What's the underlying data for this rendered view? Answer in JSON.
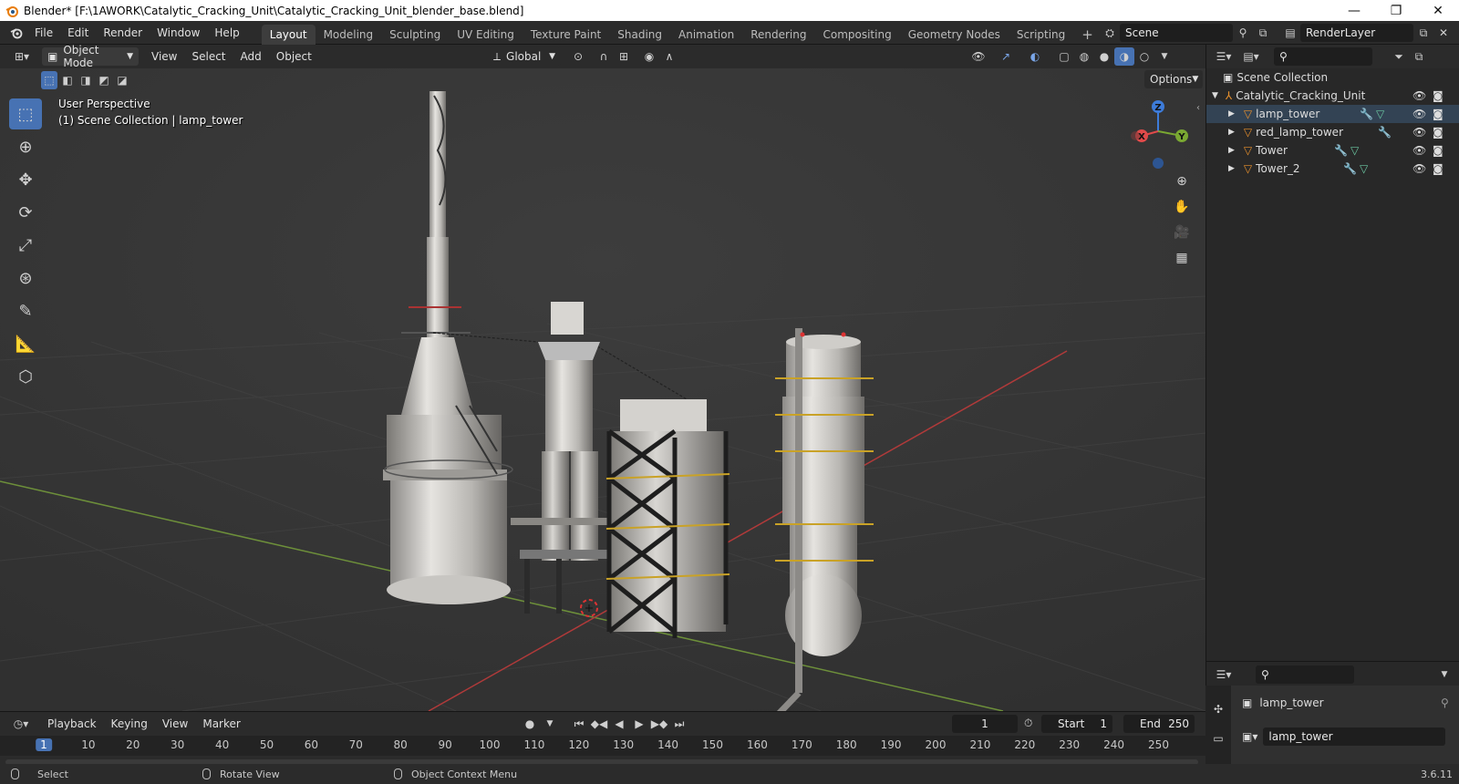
{
  "titlebar": {
    "title": "Blender* [F:\\1AWORK\\Catalytic_Cracking_Unit\\Catalytic_Cracking_Unit_blender_base.blend]",
    "minimize": "—",
    "maximize": "❐",
    "close": "✕"
  },
  "menu": [
    "File",
    "Edit",
    "Render",
    "Window",
    "Help"
  ],
  "workspaces": [
    "Layout",
    "Modeling",
    "Sculpting",
    "UV Editing",
    "Texture Paint",
    "Shading",
    "Animation",
    "Rendering",
    "Compositing",
    "Geometry Nodes",
    "Scripting"
  ],
  "active_workspace": "Layout",
  "add_workspace": "+",
  "scene": {
    "value": "Scene"
  },
  "view_layer": {
    "value": "RenderLayer"
  },
  "viewport_header": {
    "mode": "Object Mode",
    "menus": [
      "View",
      "Select",
      "Add",
      "Object"
    ],
    "orientation": "Global",
    "options": "Options"
  },
  "viewport_overlay": {
    "perspective": "User Perspective",
    "collection_info": "(1) Scene Collection | lamp_tower"
  },
  "gizmo": {
    "z": "Z",
    "y": "Y",
    "x": "X"
  },
  "outliner": {
    "root": "Scene Collection",
    "collection": "Catalytic_Cracking_Unit",
    "objects": [
      {
        "name": "lamp_tower"
      },
      {
        "name": "red_lamp_tower"
      },
      {
        "name": "Tower"
      },
      {
        "name": "Tower_2"
      }
    ]
  },
  "properties": {
    "object_name": "lamp_tower",
    "data_name": "lamp_tower"
  },
  "timeline": {
    "menus": [
      "Playback",
      "Keying",
      "View",
      "Marker"
    ],
    "current_frame": "1",
    "start_label": "Start",
    "start": "1",
    "end_label": "End",
    "end": "250",
    "ticks": [
      "1",
      "10",
      "20",
      "30",
      "40",
      "50",
      "60",
      "70",
      "80",
      "90",
      "100",
      "110",
      "120",
      "130",
      "140",
      "150",
      "160",
      "170",
      "180",
      "190",
      "200",
      "210",
      "220",
      "230",
      "240",
      "250"
    ]
  },
  "statusbar": {
    "select": "Select",
    "rotate": "Rotate View",
    "context": "Object Context Menu",
    "version": "3.6.11"
  },
  "colors": {
    "accent": "#4772b3",
    "axis_x": "#e04a4a",
    "axis_y": "#7aa832",
    "axis_z": "#3d7bd9",
    "object_icon": "#e8902c"
  }
}
